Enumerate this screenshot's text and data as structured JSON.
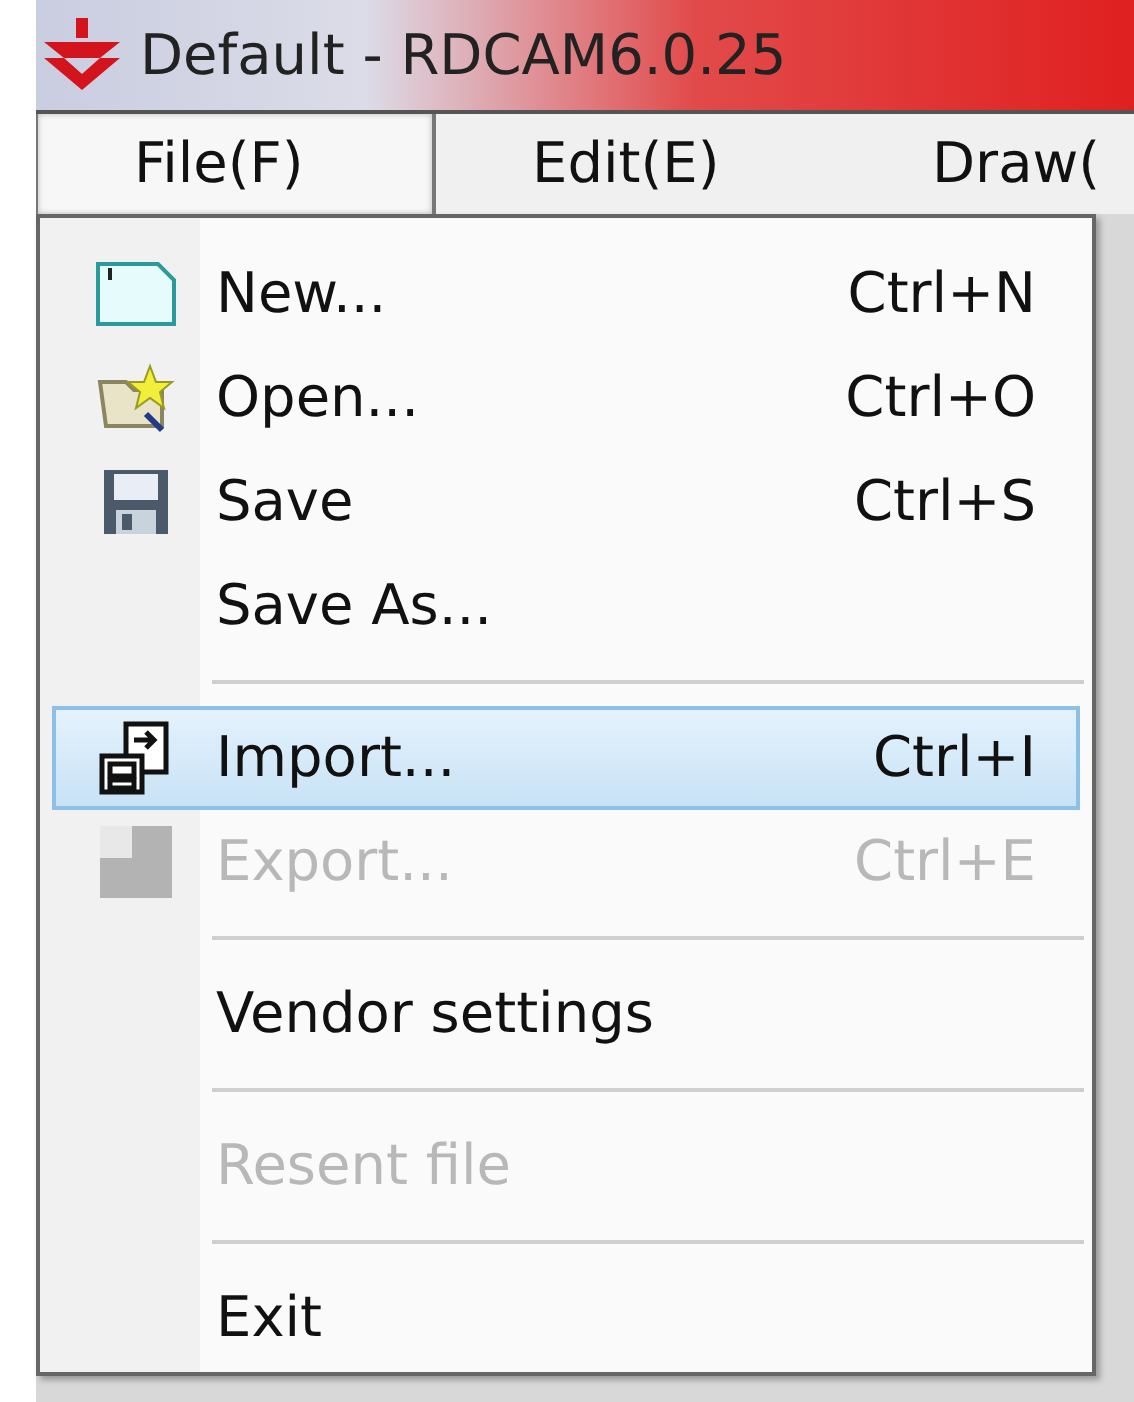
{
  "window": {
    "title": "Default - RDCAM6.0.25"
  },
  "menubar": [
    {
      "label": "File(F)",
      "selected": true
    },
    {
      "label": "Edit(E)",
      "selected": false
    },
    {
      "label": "Draw(",
      "selected": false
    }
  ],
  "file_menu": [
    {
      "kind": "item",
      "label": "New...",
      "shortcut": "Ctrl+N",
      "disabled": false,
      "selected": false
    },
    {
      "kind": "item",
      "label": "Open...",
      "shortcut": "Ctrl+O",
      "disabled": false,
      "selected": false
    },
    {
      "kind": "item",
      "label": "Save",
      "shortcut": "Ctrl+S",
      "disabled": false,
      "selected": false
    },
    {
      "kind": "item",
      "label": "Save As...",
      "disabled": false,
      "selected": false
    },
    {
      "kind": "separator"
    },
    {
      "kind": "item",
      "label": "Import...",
      "shortcut": "Ctrl+I",
      "disabled": false,
      "selected": true
    },
    {
      "kind": "item",
      "label": "Export...",
      "shortcut": "Ctrl+E",
      "disabled": true,
      "selected": false
    },
    {
      "kind": "separator"
    },
    {
      "kind": "item",
      "label": "Vendor settings",
      "disabled": false,
      "selected": false
    },
    {
      "kind": "separator"
    },
    {
      "kind": "item",
      "label": "Resent file",
      "disabled": true,
      "selected": false
    },
    {
      "kind": "separator"
    },
    {
      "kind": "item",
      "label": "Exit",
      "disabled": false,
      "selected": false
    }
  ]
}
